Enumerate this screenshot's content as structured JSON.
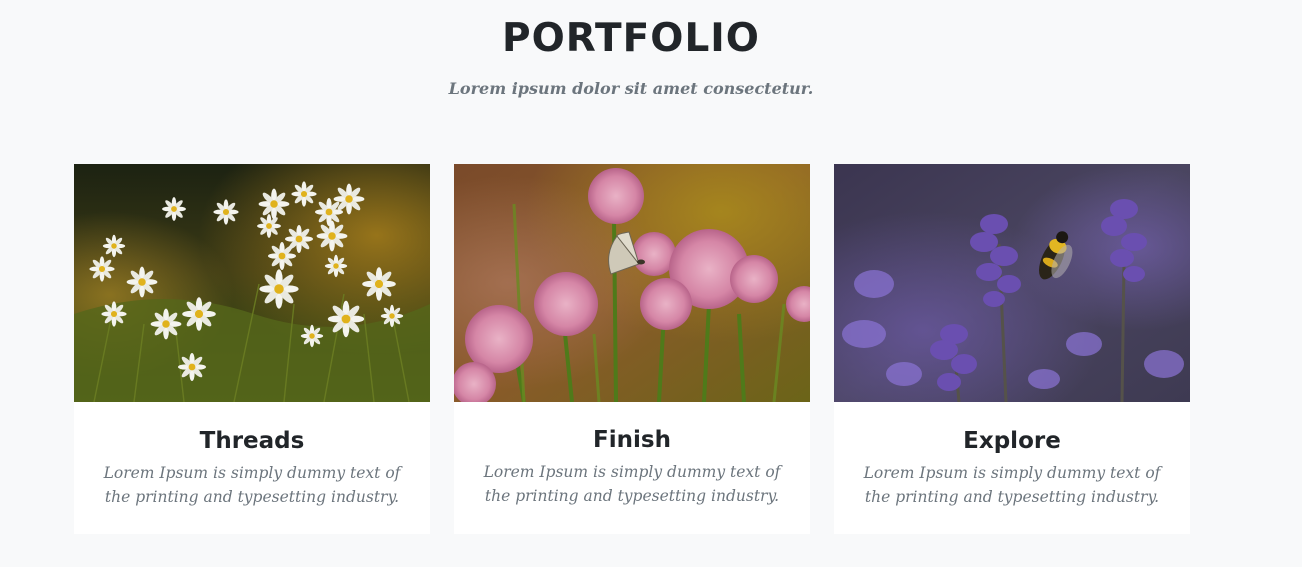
{
  "portfolio": {
    "title": "PORTFOLIO",
    "subtitle": "Lorem ipsum dolor sit amet consectetur.",
    "items": [
      {
        "image": "white-daisies-photo",
        "title": "Threads",
        "description": "Lorem Ipsum is simply dummy text of the printing and typesetting industry."
      },
      {
        "image": "pink-chive-flowers-butterfly-photo",
        "title": "Finish",
        "description": "Lorem Ipsum is simply dummy text of the printing and typesetting industry."
      },
      {
        "image": "lavender-bee-photo",
        "title": "Explore",
        "description": "Lorem Ipsum is simply dummy text of the printing and typesetting industry."
      }
    ]
  },
  "colors": {
    "background": "#f8f9fa",
    "card": "#ffffff",
    "heading": "#212529",
    "muted": "#6c757d"
  }
}
